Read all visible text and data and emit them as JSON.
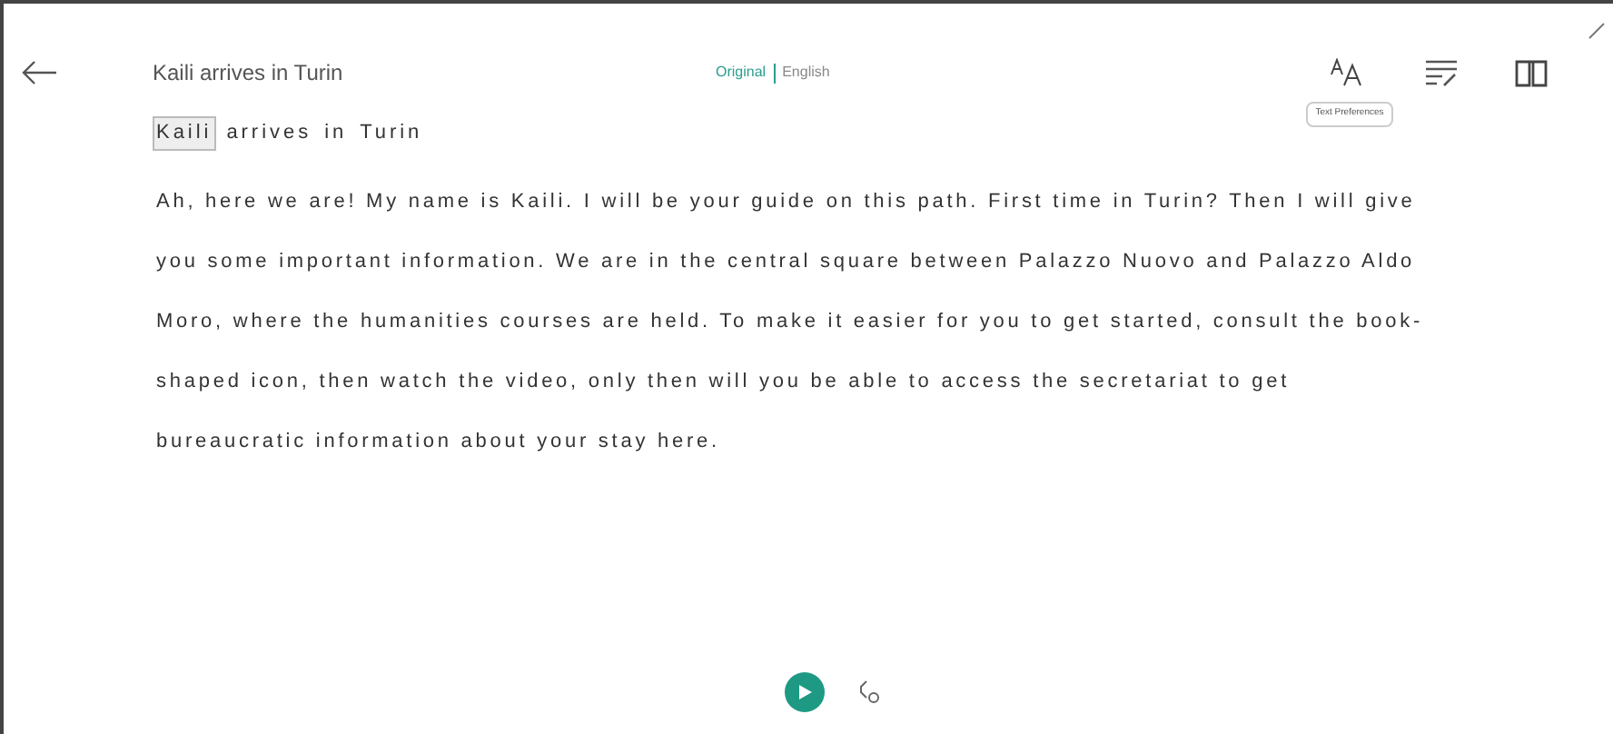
{
  "header": {
    "title": "Kaili arrives in Turin",
    "languages": [
      {
        "label": "Original",
        "selected": true
      },
      {
        "label": "English",
        "selected": false
      }
    ],
    "tooltip": "Text Preferences"
  },
  "heading": [
    {
      "text": "Kaili",
      "highlighted": true
    },
    {
      "text": "arrives",
      "highlighted": false
    },
    {
      "text": "in",
      "highlighted": false
    },
    {
      "text": "Turin",
      "highlighted": false
    }
  ],
  "body": "Ah, here we are! My name is Kaili. I will be your guide on this path. First time in Turin? Then I will give you some important information. We are in the central square between Palazzo Nuovo and Palazzo Aldo Moro, where the humanities courses are held. To make it easier for you to get started, consult the book-shaped icon, then watch the video, only then will you be able to access the secretariat to get bureaucratic information about your stay here."
}
